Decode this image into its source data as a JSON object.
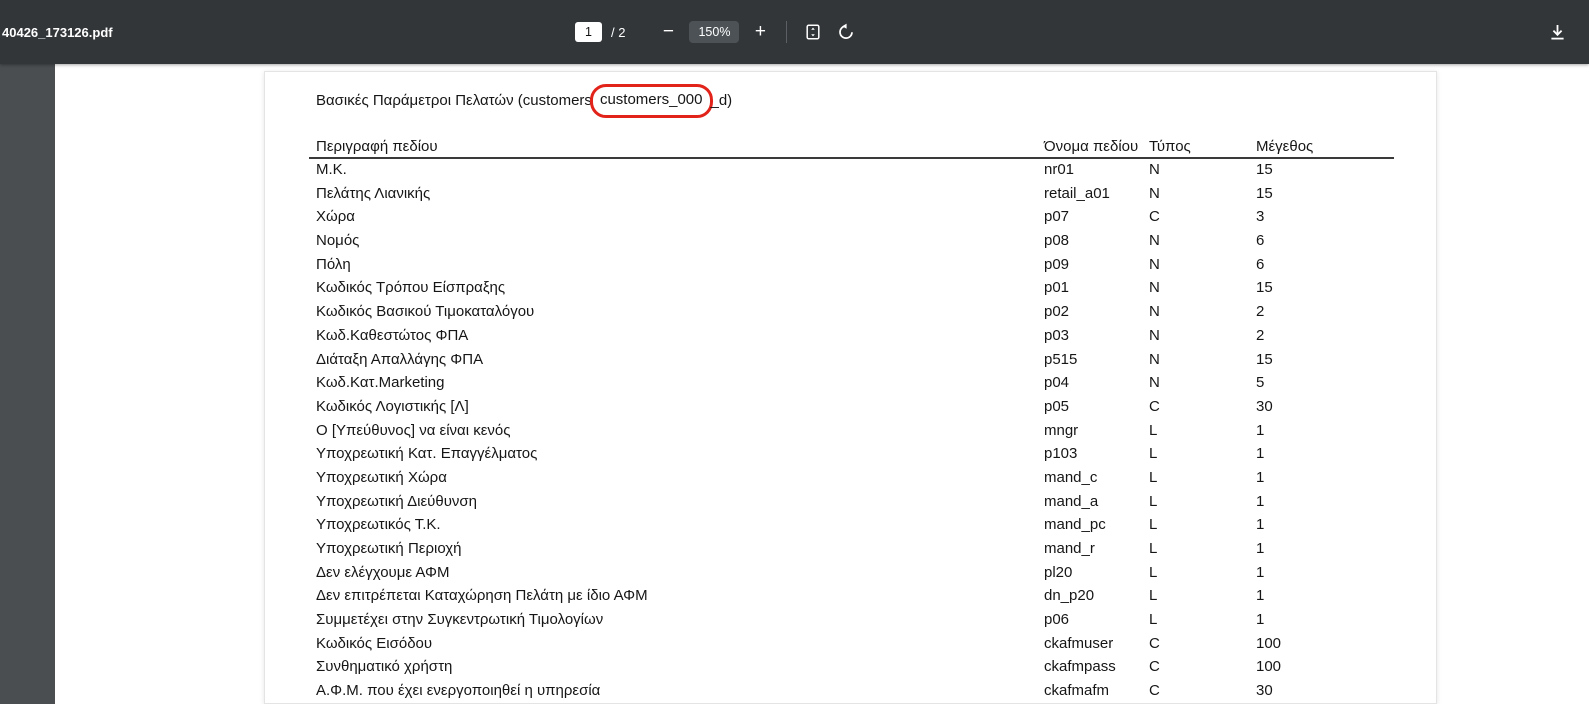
{
  "colors": {
    "annotation_red": "#e2231a",
    "toolbar_bg": "#323639"
  },
  "toolbar": {
    "filename": "40426_173126.pdf",
    "page_current": "1",
    "page_count_label": "/ 2",
    "zoom_out_label": "−",
    "zoom_level": "150%",
    "zoom_in_label": "+",
    "icons": {
      "fit_page": "⛶",
      "rotate_ccw": "⟲",
      "download": "⤓"
    }
  },
  "document": {
    "title_prefix": "Βασικές Παράμετροι Πελατών (customers",
    "title_circled": "customers_000",
    "title_suffix": "_d)",
    "table": {
      "headers": [
        "Περιγραφή πεδίου",
        "Όνομα πεδίου",
        "Τύπος",
        "Μέγεθος"
      ],
      "rows": [
        [
          "Μ.Κ.",
          "nr01",
          "N",
          "15"
        ],
        [
          "Πελάτης Λιανικής",
          "retail_a01",
          "N",
          "15"
        ],
        [
          "Χώρα",
          "p07",
          "C",
          "3"
        ],
        [
          "Νομός",
          "p08",
          "N",
          "6"
        ],
        [
          "Πόλη",
          "p09",
          "N",
          "6"
        ],
        [
          "Κωδικός Τρόπου Είσπραξης",
          "p01",
          "N",
          "15"
        ],
        [
          "Κωδικός Βασικού Τιμοκαταλόγου",
          "p02",
          "N",
          "2"
        ],
        [
          "Κωδ.Καθεστώτος ΦΠΑ",
          "p03",
          "N",
          "2"
        ],
        [
          "Διάταξη Απαλλάγης ΦΠΑ",
          "p515",
          "N",
          "15"
        ],
        [
          "Κωδ.Κατ.Marketing",
          "p04",
          "N",
          "5"
        ],
        [
          "Κωδικός Λογιστικής [Λ]",
          "p05",
          "C",
          "30"
        ],
        [
          "Ο [Υπεύθυνος] να είναι κενός",
          "mngr",
          "L",
          "1"
        ],
        [
          "Υποχρεωτική Κατ. Επαγγέλματος",
          "p103",
          "L",
          "1"
        ],
        [
          "Υποχρεωτική Χώρα",
          "mand_c",
          "L",
          "1"
        ],
        [
          "Υποχρεωτική Διεύθυνση",
          "mand_a",
          "L",
          "1"
        ],
        [
          "Υποχρεωτικός Τ.Κ.",
          "mand_pc",
          "L",
          "1"
        ],
        [
          "Υποχρεωτική Περιοχή",
          "mand_r",
          "L",
          "1"
        ],
        [
          "Δεν ελέγχουμε ΑΦΜ",
          "pl20",
          "L",
          "1"
        ],
        [
          "Δεν επιτρέπεται Καταχώρηση Πελάτη με ίδιο ΑΦΜ",
          "dn_p20",
          "L",
          "1"
        ],
        [
          "Συμμετέχει στην Συγκεντρωτική Τιμολογίων",
          "p06",
          "L",
          "1"
        ],
        [
          "Κωδικός Εισόδου",
          "ckafmuser",
          "C",
          "100"
        ],
        [
          "Συνθηματικό χρήστη",
          "ckafmpass",
          "C",
          "100"
        ],
        [
          "Α.Φ.Μ. που έχει ενεργοποιηθεί η υπηρεσία",
          "ckafmafm",
          "C",
          "30"
        ]
      ]
    }
  }
}
